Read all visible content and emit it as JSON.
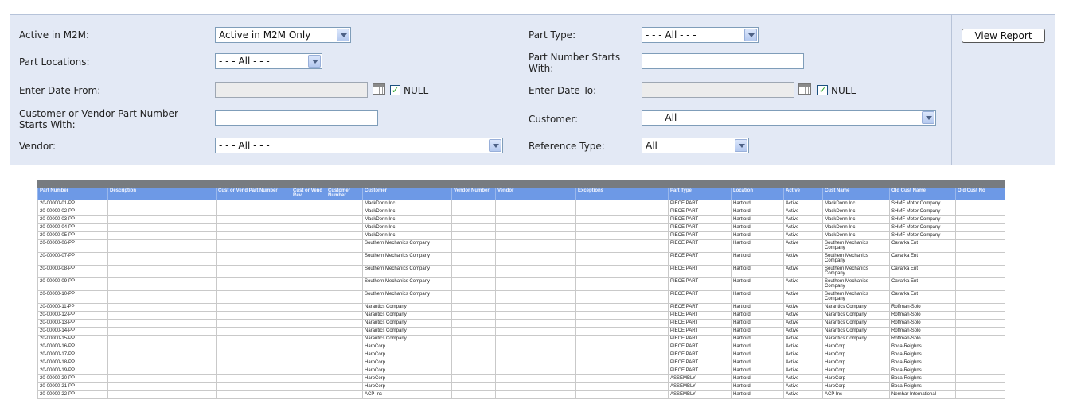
{
  "params": {
    "active_label": "Active in M2M:",
    "active_value": "Active in M2M Only",
    "part_locations_label": "Part Locations:",
    "part_locations_value": "- - - All - - -",
    "enter_date_from_label": "Enter Date From:",
    "date_from_null_label": "NULL",
    "cust_vend_part_label": "Customer or Vendor Part Number Starts With:",
    "vendor_label": "Vendor:",
    "vendor_value": "- - - All - - -",
    "part_type_label": "Part Type:",
    "part_type_value": "- - - All - - -",
    "part_number_label": "Part Number Starts With:",
    "enter_date_to_label": "Enter Date To:",
    "date_to_null_label": "NULL",
    "customer_label": "Customer:",
    "customer_value": "- - - All - - -",
    "reference_type_label": "Reference Type:",
    "reference_type_value": "All",
    "view_report_label": "View Report",
    "date_from_null_checked": true,
    "date_to_null_checked": true
  },
  "table": {
    "headers": [
      "Part Number",
      "Description",
      "Cust or Vend Part Number",
      "Cust or Vend Rev",
      "Customer Number",
      "Customer",
      "Vendor Number",
      "Vendor",
      "Exceptions",
      "Part Type",
      "Location",
      "Active",
      "Cust Name",
      "Old Cust Name",
      "Old Cust No"
    ],
    "rows": [
      [
        "20-00000-01-PP",
        "",
        "",
        "",
        "",
        "MackDonn Inc",
        "",
        "",
        "",
        "PIECE PART",
        "Hartford",
        "Active",
        "MackDonn Inc",
        "SHMF Motor Company",
        ""
      ],
      [
        "20-00000-02-PP",
        "",
        "",
        "",
        "",
        "MackDonn Inc",
        "",
        "",
        "",
        "PIECE PART",
        "Hartford",
        "Active",
        "MackDonn Inc",
        "SHMF Motor Company",
        ""
      ],
      [
        "20-00000-03-PP",
        "",
        "",
        "",
        "",
        "MackDonn Inc",
        "",
        "",
        "",
        "PIECE PART",
        "Hartford",
        "Active",
        "MackDonn Inc",
        "SHMF Motor Company",
        ""
      ],
      [
        "20-00000-04-PP",
        "",
        "",
        "",
        "",
        "MackDonn Inc",
        "",
        "",
        "",
        "PIECE PART",
        "Hartford",
        "Active",
        "MackDonn Inc",
        "SHMF Motor Company",
        ""
      ],
      [
        "20-00000-05-PP",
        "",
        "",
        "",
        "",
        "MackDonn Inc",
        "",
        "",
        "",
        "PIECE PART",
        "Hartford",
        "Active",
        "MackDonn Inc",
        "SHMF Motor Company",
        ""
      ],
      [
        "20-00000-06-PP",
        "",
        "",
        "",
        "",
        "Southern Mechanics Company",
        "",
        "",
        "",
        "PIECE PART",
        "Hartford",
        "Active",
        "Southern Mechanics Company",
        "Cavarka Ent",
        ""
      ],
      [
        "20-00000-07-PP",
        "",
        "",
        "",
        "",
        "Southern Mechanics Company",
        "",
        "",
        "",
        "PIECE PART",
        "Hartford",
        "Active",
        "Southern Mechanics Company",
        "Cavarka Ent",
        ""
      ],
      [
        "20-00000-08-PP",
        "",
        "",
        "",
        "",
        "Southern Mechanics Company",
        "",
        "",
        "",
        "PIECE PART",
        "Hartford",
        "Active",
        "Southern Mechanics Company",
        "Cavarka Ent",
        ""
      ],
      [
        "20-00000-09-PP",
        "",
        "",
        "",
        "",
        "Southern Mechanics Company",
        "",
        "",
        "",
        "PIECE PART",
        "Hartford",
        "Active",
        "Southern Mechanics Company",
        "Cavarka Ent",
        ""
      ],
      [
        "20-00000-10-PP",
        "",
        "",
        "",
        "",
        "Southern Mechanics Company",
        "",
        "",
        "",
        "PIECE PART",
        "Hartford",
        "Active",
        "Southern Mechanics Company",
        "Cavarka Ent",
        ""
      ],
      [
        "20-00000-11-PP",
        "",
        "",
        "",
        "",
        "Narantics Company",
        "",
        "",
        "",
        "PIECE PART",
        "Hartford",
        "Active",
        "Narantics Company",
        "Roffman-Solo",
        ""
      ],
      [
        "20-00000-12-PP",
        "",
        "",
        "",
        "",
        "Narantics Company",
        "",
        "",
        "",
        "PIECE PART",
        "Hartford",
        "Active",
        "Narantics Company",
        "Roffman-Solo",
        ""
      ],
      [
        "20-00000-13-PP",
        "",
        "",
        "",
        "",
        "Narantics Company",
        "",
        "",
        "",
        "PIECE PART",
        "Hartford",
        "Active",
        "Narantics Company",
        "Roffman-Solo",
        ""
      ],
      [
        "20-00000-14-PP",
        "",
        "",
        "",
        "",
        "Narantics Company",
        "",
        "",
        "",
        "PIECE PART",
        "Hartford",
        "Active",
        "Narantics Company",
        "Roffman-Solo",
        ""
      ],
      [
        "20-00000-15-PP",
        "",
        "",
        "",
        "",
        "Narantics Company",
        "",
        "",
        "",
        "PIECE PART",
        "Hartford",
        "Active",
        "Narantics Company",
        "Roffman-Solo",
        ""
      ],
      [
        "20-00000-16-PP",
        "",
        "",
        "",
        "",
        "HaroCorp",
        "",
        "",
        "",
        "PIECE PART",
        "Hartford",
        "Active",
        "HaroCorp",
        "Boca-Reighns",
        ""
      ],
      [
        "20-00000-17-PP",
        "",
        "",
        "",
        "",
        "HaroCorp",
        "",
        "",
        "",
        "PIECE PART",
        "Hartford",
        "Active",
        "HaroCorp",
        "Boca-Reighns",
        ""
      ],
      [
        "20-00000-18-PP",
        "",
        "",
        "",
        "",
        "HaroCorp",
        "",
        "",
        "",
        "PIECE PART",
        "Hartford",
        "Active",
        "HaroCorp",
        "Boca-Reighns",
        ""
      ],
      [
        "20-00000-19-PP",
        "",
        "",
        "",
        "",
        "HaroCorp",
        "",
        "",
        "",
        "PIECE PART",
        "Hartford",
        "Active",
        "HaroCorp",
        "Boca-Reighns",
        ""
      ],
      [
        "20-00000-20-PP",
        "",
        "",
        "",
        "",
        "HaroCorp",
        "",
        "",
        "",
        "ASSEMBLY",
        "Hartford",
        "Active",
        "HaroCorp",
        "Boca-Reighns",
        ""
      ],
      [
        "20-00000-21-PP",
        "",
        "",
        "",
        "",
        "HaroCorp",
        "",
        "",
        "",
        "ASSEMBLY",
        "Hartford",
        "Active",
        "HaroCorp",
        "Boca-Reighns",
        ""
      ],
      [
        "20-00000-22-PP",
        "",
        "",
        "",
        "",
        "ACP Inc",
        "",
        "",
        "",
        "ASSEMBLY",
        "Hartford",
        "Active",
        "ACP Inc",
        "Nemhar International",
        ""
      ]
    ]
  },
  "colors": {
    "panel_bg": "#e3e9f5",
    "header_bg": "#6d99e6",
    "top_bar": "#777b80"
  }
}
